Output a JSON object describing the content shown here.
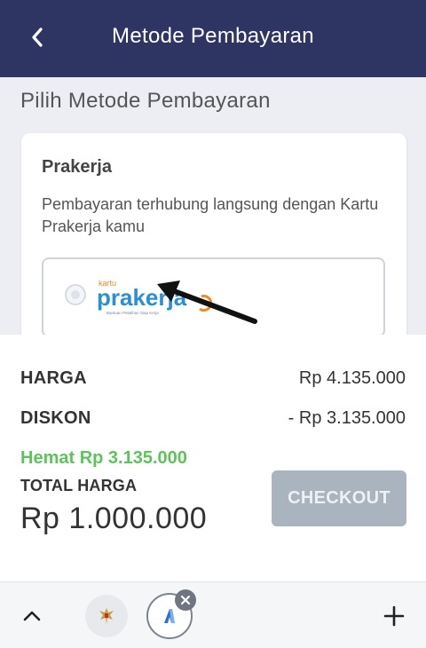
{
  "header": {
    "title": "Metode Pembayaran",
    "back_icon": "chevron-left-icon"
  },
  "section": {
    "title": "Pilih Metode Pembayaran"
  },
  "payment_card": {
    "title": "Prakerja",
    "description": "Pembayaran terhubung langsung dengan Kartu Prakerja kamu",
    "option": {
      "selected": false,
      "logo_top": "kartu",
      "logo_main": "prakerja",
      "logo_tagline": "Bantuan Pelatihan Siap Kerja"
    }
  },
  "summary": {
    "harga_label": "HARGA",
    "harga_value": "Rp 4.135.000",
    "diskon_label": "DISKON",
    "diskon_value": "- Rp 3.135.000",
    "hemat_text": "Hemat Rp 3.135.000",
    "total_label": "TOTAL HARGA",
    "total_value": "Rp 1.000.000",
    "checkout_label": "CHECKOUT"
  },
  "bottom_bar": {
    "icons": [
      "chevron-up-icon",
      "garuda-emblem-icon",
      "app-icon",
      "close-icon",
      "plus-icon"
    ]
  },
  "colors": {
    "header_bg": "#2e3563",
    "accent_green": "#5cc45a",
    "checkout_disabled": "#aab4be",
    "logo_blue": "#2b8fd6",
    "logo_orange": "#f08a24"
  }
}
